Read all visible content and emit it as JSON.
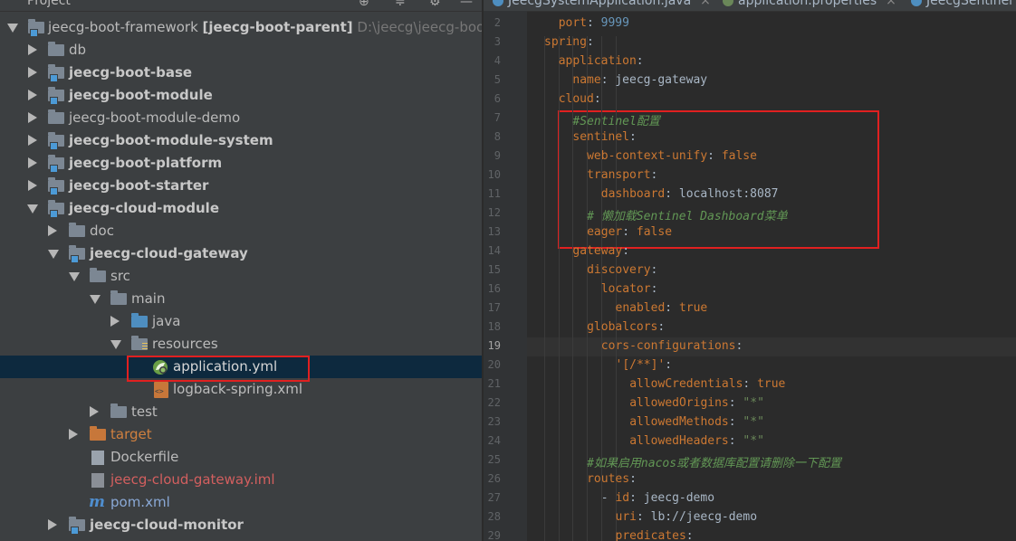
{
  "project_panel": {
    "title": "Project",
    "tree": [
      {
        "label": "jeecg-boot-framework",
        "suffix": "[jeecg-boot-parent]",
        "path": "D:\\jeecg\\jeecg-boot-frame"
      },
      {
        "label": "db"
      },
      {
        "label": "jeecg-boot-base"
      },
      {
        "label": "jeecg-boot-module"
      },
      {
        "label": "jeecg-boot-module-demo"
      },
      {
        "label": "jeecg-boot-module-system"
      },
      {
        "label": "jeecg-boot-platform"
      },
      {
        "label": "jeecg-boot-starter"
      },
      {
        "label": "jeecg-cloud-module"
      },
      {
        "label": "doc"
      },
      {
        "label": "jeecg-cloud-gateway"
      },
      {
        "label": "src"
      },
      {
        "label": "main"
      },
      {
        "label": "java"
      },
      {
        "label": "resources"
      },
      {
        "label": "application.yml"
      },
      {
        "label": "logback-spring.xml"
      },
      {
        "label": "test"
      },
      {
        "label": "target"
      },
      {
        "label": "Dockerfile"
      },
      {
        "label": "jeecg-cloud-gateway.iml"
      },
      {
        "label": "pom.xml"
      },
      {
        "label": "jeecg-cloud-monitor"
      }
    ]
  },
  "editor": {
    "tabs": [
      {
        "label": "JeecgSystemApplication.java"
      },
      {
        "label": "application.properties"
      },
      {
        "label": "JeecgSentinel"
      }
    ],
    "line_numbers": [
      "2",
      "3",
      "4",
      "5",
      "6",
      "7",
      "8",
      "9",
      "10",
      "11",
      "12",
      "13",
      "14",
      "15",
      "16",
      "17",
      "18",
      "19",
      "20",
      "21",
      "22",
      "23",
      "24",
      "25",
      "26",
      "27",
      "28",
      "29"
    ],
    "current_line": "19",
    "lines": [
      {
        "key": "port",
        "punct": ": ",
        "value": "9999"
      },
      {
        "key": "spring",
        "punct": ":"
      },
      {
        "key": "application",
        "punct": ":"
      },
      {
        "key": "name",
        "punct": ": ",
        "value": "jeecg-gateway"
      },
      {
        "key": "cloud",
        "punct": ":"
      },
      {
        "comment": "#Sentinel配置"
      },
      {
        "key": "sentinel",
        "punct": ":"
      },
      {
        "key": "web-context-unify",
        "punct": ": ",
        "value": "false"
      },
      {
        "key": "transport",
        "punct": ":"
      },
      {
        "key": "dashboard",
        "punct": ": ",
        "value": "localhost:8087"
      },
      {
        "comment": "# 懒加载Sentinel Dashboard菜单"
      },
      {
        "key": "eager",
        "punct": ": ",
        "value": "false"
      },
      {
        "key": "gateway",
        "punct": ":"
      },
      {
        "key": "discovery",
        "punct": ":"
      },
      {
        "key": "locator",
        "punct": ":"
      },
      {
        "key": "enabled",
        "punct": ": ",
        "value": "true"
      },
      {
        "key": "globalcors",
        "punct": ":"
      },
      {
        "key": "cors-configurations",
        "punct": ":"
      },
      {
        "key": "'[/**]'",
        "punct": ":"
      },
      {
        "key": "allowCredentials",
        "punct": ": ",
        "value": "true"
      },
      {
        "key": "allowedOrigins",
        "punct": ": ",
        "value": "\"*\""
      },
      {
        "key": "allowedMethods",
        "punct": ": ",
        "value": "\"*\""
      },
      {
        "key": "allowedHeaders",
        "punct": ": ",
        "value": "\"*\""
      },
      {
        "comment": "#如果启用nacos或者数据库配置请删除一下配置"
      },
      {
        "key": "routes",
        "punct": ":"
      },
      {
        "dash": "- ",
        "key": "id",
        "punct": ": ",
        "value": "jeecg-demo"
      },
      {
        "key": "uri",
        "punct": ": ",
        "value": "lb://jeecg-demo"
      },
      {
        "key": "predicates",
        "punct": ":"
      }
    ]
  }
}
